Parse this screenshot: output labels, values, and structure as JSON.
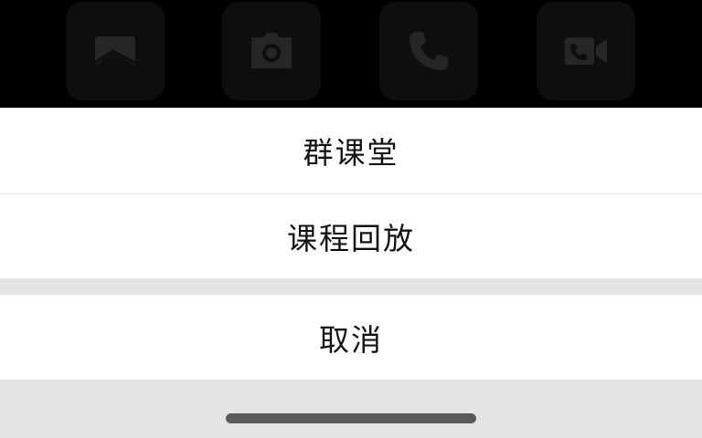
{
  "toolbar": {
    "tools": [
      {
        "icon": "image-icon"
      },
      {
        "icon": "camera-icon"
      },
      {
        "icon": "phone-icon"
      },
      {
        "icon": "video-call-icon"
      }
    ],
    "tile_color": "#0e0e0e",
    "icon_color": "#2a2a2a"
  },
  "action_sheet": {
    "options": [
      {
        "label": "群课堂"
      },
      {
        "label": "课程回放"
      }
    ],
    "cancel_label": "取消",
    "option_background": "#ffffff",
    "gap_background": "#e4e4e4",
    "text_color": "#141414"
  }
}
